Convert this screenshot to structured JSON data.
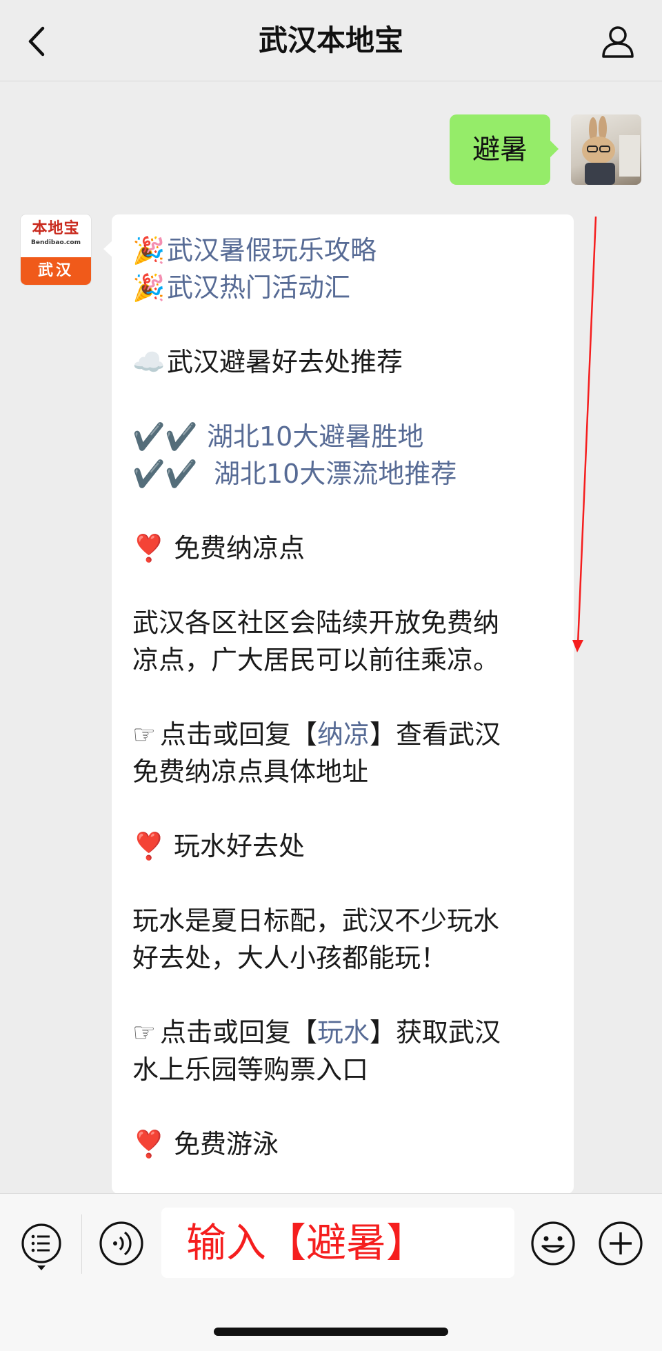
{
  "nav": {
    "title": "武汉本地宝"
  },
  "sent_message": {
    "text": "避暑"
  },
  "sender_avatar": {
    "brand": "本地宝",
    "brand_domain": "Bendibao.com",
    "city": "武汉"
  },
  "reply": {
    "lines": {
      "l1_emoji": "🎉",
      "l1_link": "武汉暑假玩乐攻略",
      "l2_emoji": "🎉",
      "l2_link": "武汉热门活动汇",
      "l3_emoji": "☁️",
      "l3_text": "武汉避暑好去处推荐",
      "l4_emoji": "✔️✔️",
      "l4_link": "湖北10大避暑胜地",
      "l5_emoji": "✔️✔️",
      "l5_link": "湖北10大漂流地推荐",
      "l6_emoji": "❣️",
      "l6_text": "免费纳凉点",
      "p1_a": "武汉各区社区会陆续开放免费纳",
      "p1_b": "凉点，广大居民可以前往乘凉。",
      "p2_hand": "☞",
      "p2_pre": "点击或回复【",
      "p2_link": "纳凉",
      "p2_post": "】查看武汉",
      "p2_b": "免费纳凉点具体地址",
      "l7_emoji": "❣️",
      "l7_text": "玩水好去处",
      "p3_a": "玩水是夏日标配，武汉不少玩水",
      "p3_b": "好去处，大人小孩都能玩！",
      "p4_hand": "☞",
      "p4_pre": "点击或回复【",
      "p4_link": "玩水",
      "p4_post": "】获取武汉",
      "p4_b": "水上乐园等购票入口",
      "l8_emoji": "❣️",
      "l8_text": "免费游泳"
    }
  },
  "input_bar": {
    "value": "输入【避暑】"
  },
  "colors": {
    "link": "#576b95",
    "sent_bubble": "#95ec69",
    "annotation": "#f51e1e"
  },
  "icons": [
    "back-icon",
    "profile-icon",
    "menu-list-icon",
    "voice-icon",
    "emoji-icon",
    "add-icon"
  ]
}
